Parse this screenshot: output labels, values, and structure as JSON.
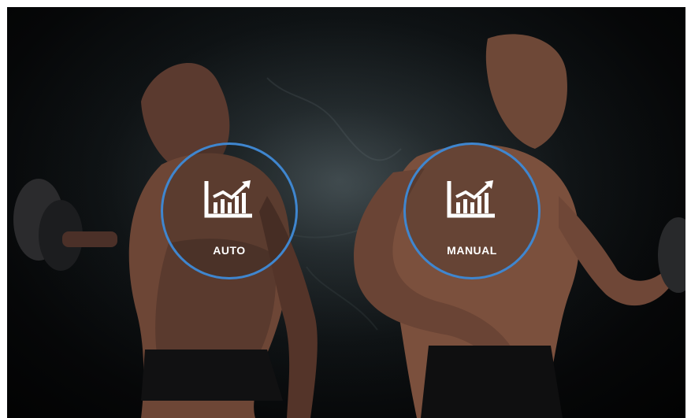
{
  "screen": {
    "background_color": "#030404",
    "ring_color": "#3f86cf"
  },
  "modes": [
    {
      "id": "auto",
      "label": "AUTO",
      "icon": "chart-trend-icon"
    },
    {
      "id": "manual",
      "label": "MANUAL",
      "icon": "chart-trend-icon"
    }
  ]
}
